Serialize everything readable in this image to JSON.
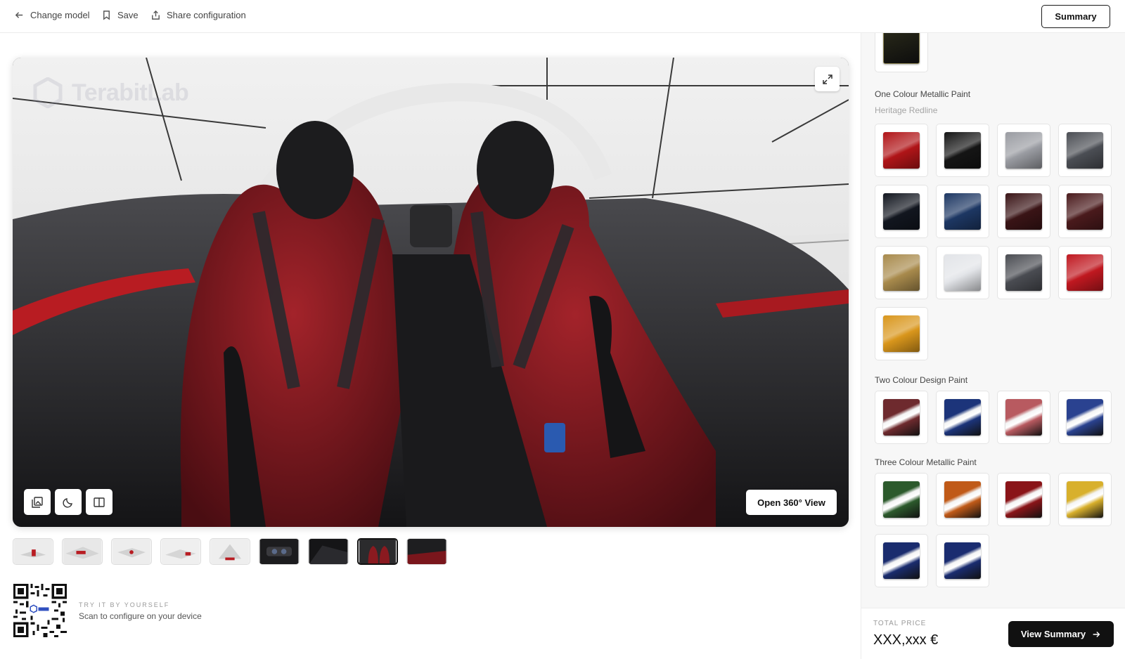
{
  "topbar": {
    "change_model": "Change model",
    "save": "Save",
    "share": "Share configuration",
    "summary": "Summary"
  },
  "viewer": {
    "watermark": "TerabitLab",
    "open_360": "Open 360° View",
    "tools": [
      "gallery-icon",
      "night-mode-icon",
      "split-view-icon"
    ]
  },
  "thumbnails": {
    "count": 9,
    "active_index": 7
  },
  "qr": {
    "label": "TRY IT BY YOURSELF",
    "text": "Scan to configure on your device"
  },
  "panel": {
    "one_colour": {
      "title": "One Colour Metallic Paint",
      "selected": "Heritage Redline",
      "swatches": [
        "#b01518",
        "#151515",
        "#9a9ca2",
        "#4b4e54",
        "#12161f",
        "#1d3763",
        "#3a1416",
        "#4a1a1c",
        "#a88a4c",
        "#e2e4e8",
        "#4a4c52",
        "#c01820",
        "#d9961c"
      ]
    },
    "two_colour": {
      "title": "Two Colour Design Paint",
      "swatches": [
        "#6e2a2e",
        "#1c347a",
        "#b85a60",
        "#2a4290"
      ]
    },
    "three_colour": {
      "title": "Three Colour Metallic Paint",
      "swatches": [
        "#2c5a2c",
        "#c05a18",
        "#8a1418",
        "#d8b02c",
        "#1a2c6e",
        "#1a2c70"
      ]
    }
  },
  "price": {
    "label": "TOTAL PRICE",
    "value": "XXX,xxx €",
    "button": "View Summary"
  }
}
